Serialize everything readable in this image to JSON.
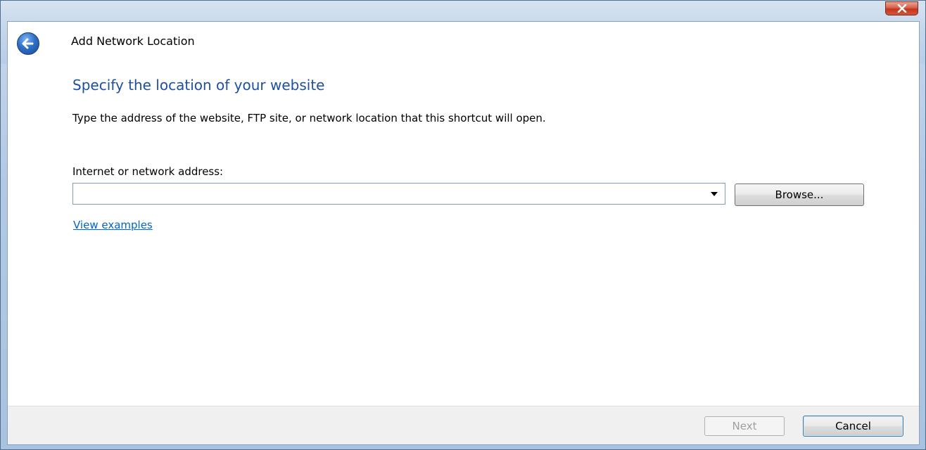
{
  "window": {
    "title": "Add Network Location",
    "close_icon": "close-icon"
  },
  "header": {
    "back_icon": "back-arrow-icon"
  },
  "content": {
    "heading": "Specify the location of your website",
    "instruction": "Type the address of the website, FTP site, or network location that this shortcut will open.",
    "address_label": "Internet or network address:",
    "address_value": "",
    "browse_label": "Browse...",
    "view_examples_label": "View examples"
  },
  "footer": {
    "next_label": "Next",
    "cancel_label": "Cancel",
    "next_enabled": false
  },
  "colors": {
    "heading": "#1e50a2",
    "link": "#0066cc",
    "close_button": "#c2351c",
    "footer_bg": "#f0f0f0"
  }
}
